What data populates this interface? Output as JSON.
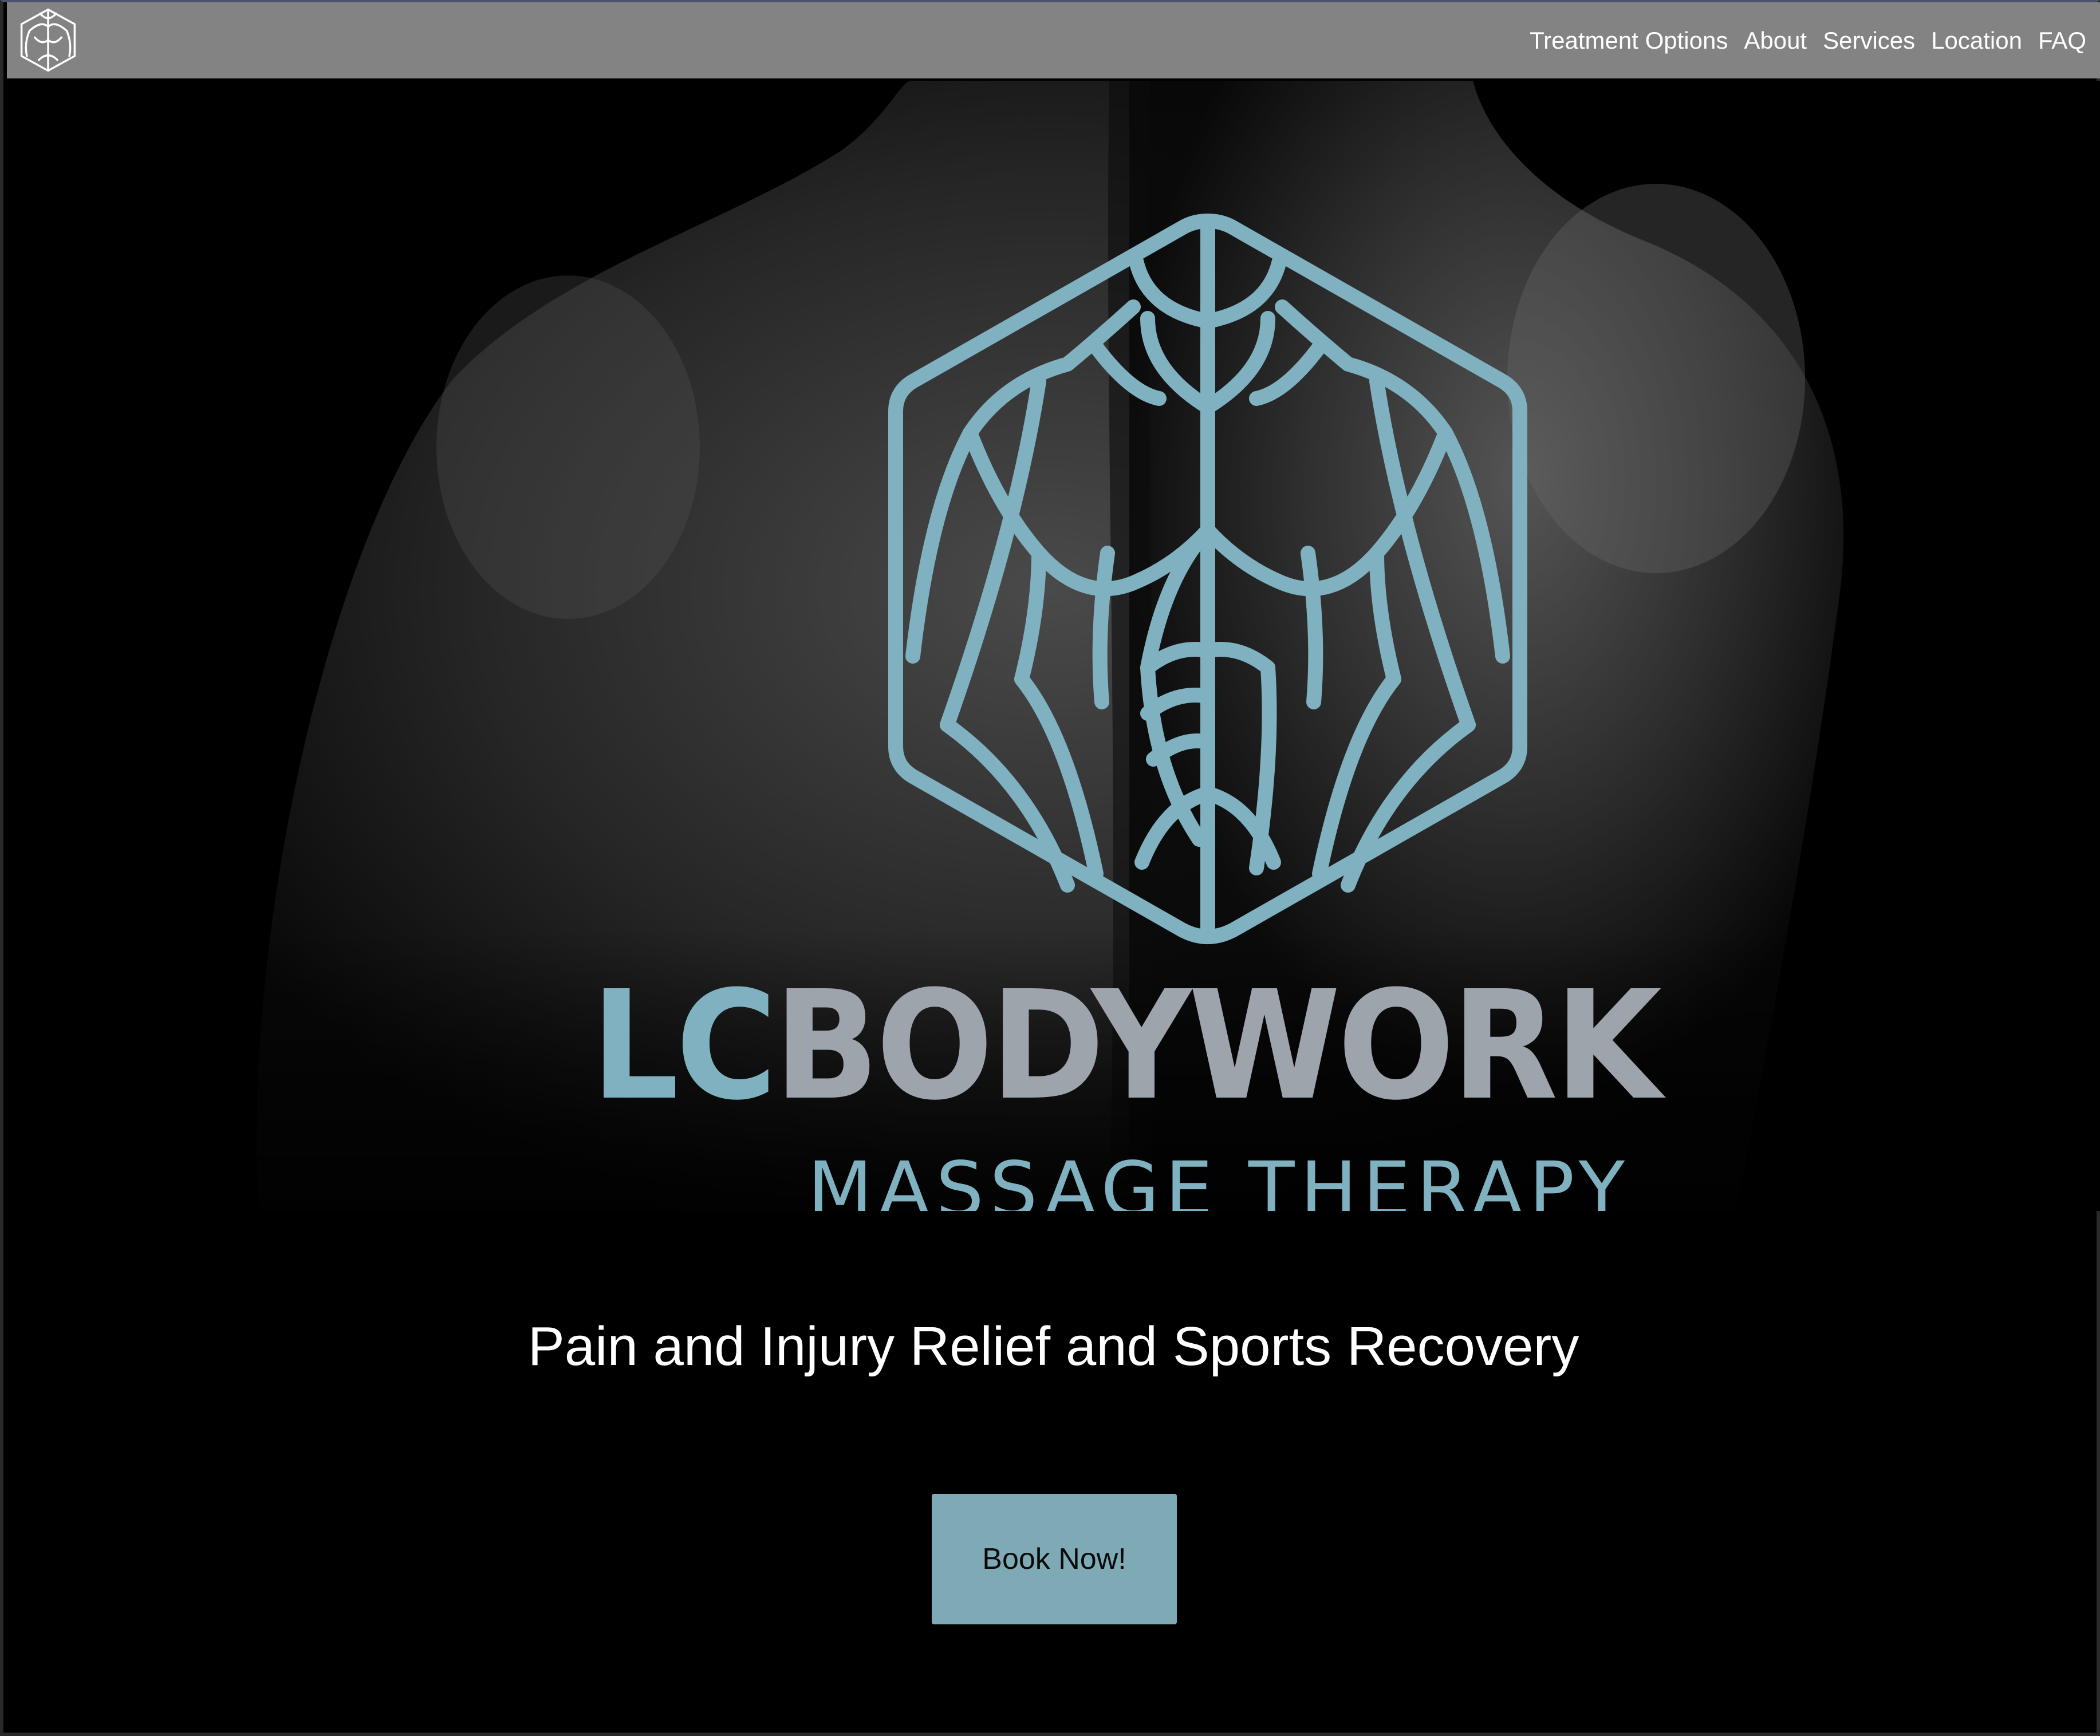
{
  "nav": {
    "logo_icon": "lc-bodywork-emblem-icon",
    "items": [
      {
        "label": "Treatment Options"
      },
      {
        "label": "About"
      },
      {
        "label": "Services"
      },
      {
        "label": "Location"
      },
      {
        "label": "FAQ"
      }
    ]
  },
  "hero": {
    "emblem_icon": "muscular-back-hexagon-icon",
    "brand_part1": "LC",
    "brand_part2": "BODYWORK",
    "subtitle": "MASSAGE THERAPY"
  },
  "main": {
    "tagline": "Pain and Injury Relief and Sports Recovery",
    "cta_label": "Book Now!"
  },
  "colors": {
    "topbar": "#838383",
    "accent_teal": "#7fb1c0",
    "brand_gray": "#9ea4ac",
    "button": "#7eaab6",
    "background": "#000000"
  }
}
